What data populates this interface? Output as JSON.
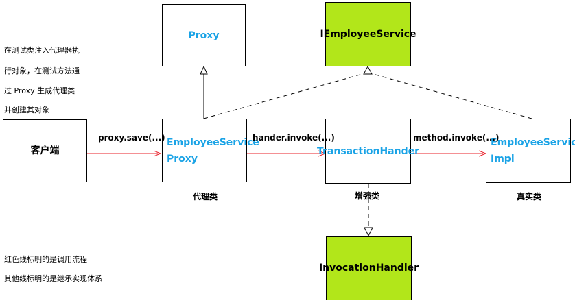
{
  "boxes": {
    "proxy": "Proxy",
    "iemployee": "IEmployeeService",
    "client": "客户端",
    "esproxy_line1": "EmployeeService",
    "esproxy_line2": "Proxy",
    "transaction": "TransactionHander",
    "esimpl_line1": "EmployeeService",
    "esimpl_line2": "Impl",
    "invocation": "InvocationHandler"
  },
  "arrows": {
    "proxy_save": "proxy.save(...)",
    "hander_invoke": "hander.invoke(...)",
    "method_invoke": "method.invoke(...)"
  },
  "captions": {
    "proxy_class": "代理类",
    "enhance_class": "增强类",
    "real_class": "真实类"
  },
  "notes": {
    "top": [
      "在测试类注入代理器执",
      "行对象，在测试方法通",
      "过 Proxy 生成代理类",
      "并创建其对象"
    ],
    "bottom": [
      "红色线标明的是调用流程",
      "其他线标明的是继承实现体系"
    ]
  },
  "colors": {
    "call_flow": "#e8202a",
    "box_fill_interface": "#b2e61a",
    "class_text": "#1aa3e6"
  }
}
